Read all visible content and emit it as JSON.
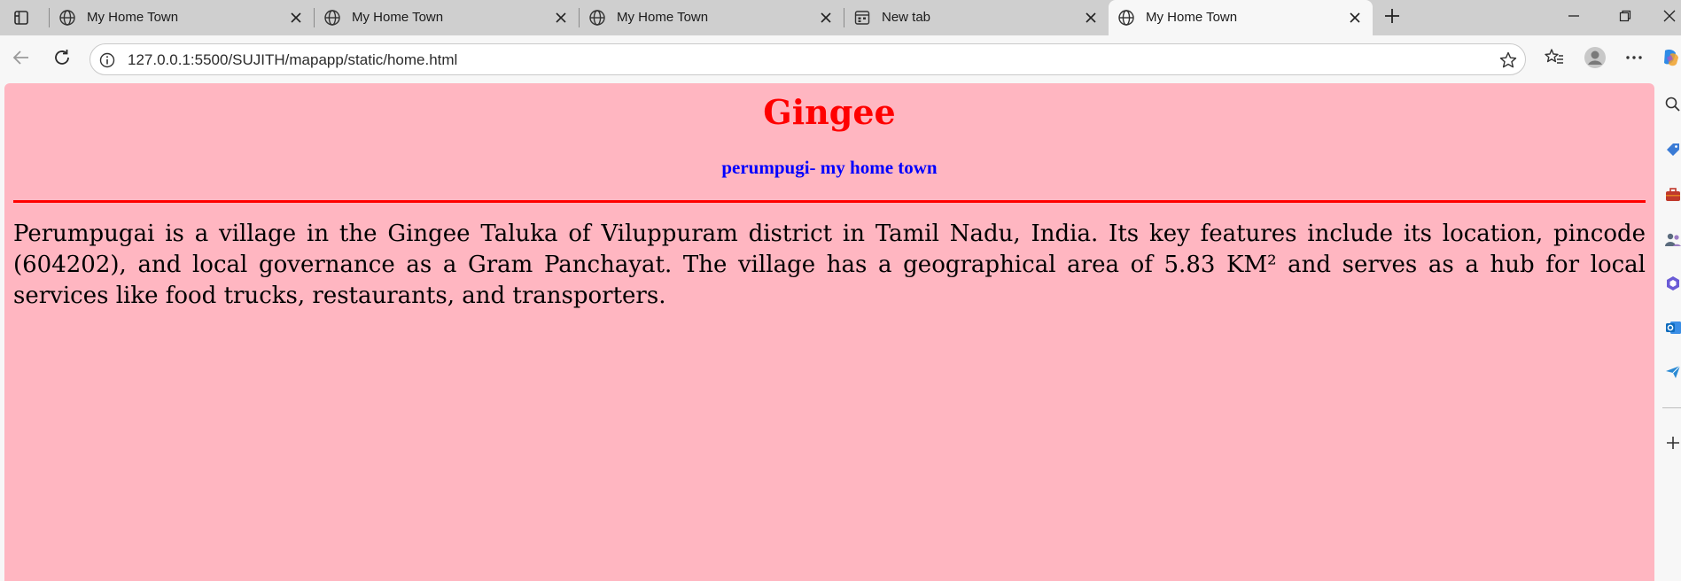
{
  "tabs": [
    {
      "title": "My Home Town",
      "icon": "globe-icon",
      "active": false
    },
    {
      "title": "My Home Town",
      "icon": "globe-icon",
      "active": false
    },
    {
      "title": "My Home Town",
      "icon": "globe-icon",
      "active": false
    },
    {
      "title": "New tab",
      "icon": "new-tab-page-icon",
      "active": false
    },
    {
      "title": "My Home Town",
      "icon": "globe-icon",
      "active": true
    }
  ],
  "toolbar": {
    "url": "127.0.0.1:5500/SUJITH/mapapp/static/home.html"
  },
  "page": {
    "title": "Gingee",
    "subtitle": "perumpugi- my home town",
    "body": "Perumpugai is a village in the Gingee Taluka of Viluppuram district in Tamil Nadu, India. Its key features include its location, pincode (604202), and local governance as a Gram Panchayat. The village has a geographical area of 5.83 KM² and serves as a hub for local services like food trucks, restaurants, and transporters."
  },
  "colors": {
    "page_background": "#ffb6c1",
    "title": "#ff0000",
    "subtitle": "#0000ff",
    "rule": "#ff0000"
  },
  "sidebar_icons": [
    "search-icon",
    "tag-icon",
    "briefcase-icon",
    "people-icon",
    "copilot-app-icon",
    "outlook-icon",
    "send-icon",
    "add-icon"
  ]
}
